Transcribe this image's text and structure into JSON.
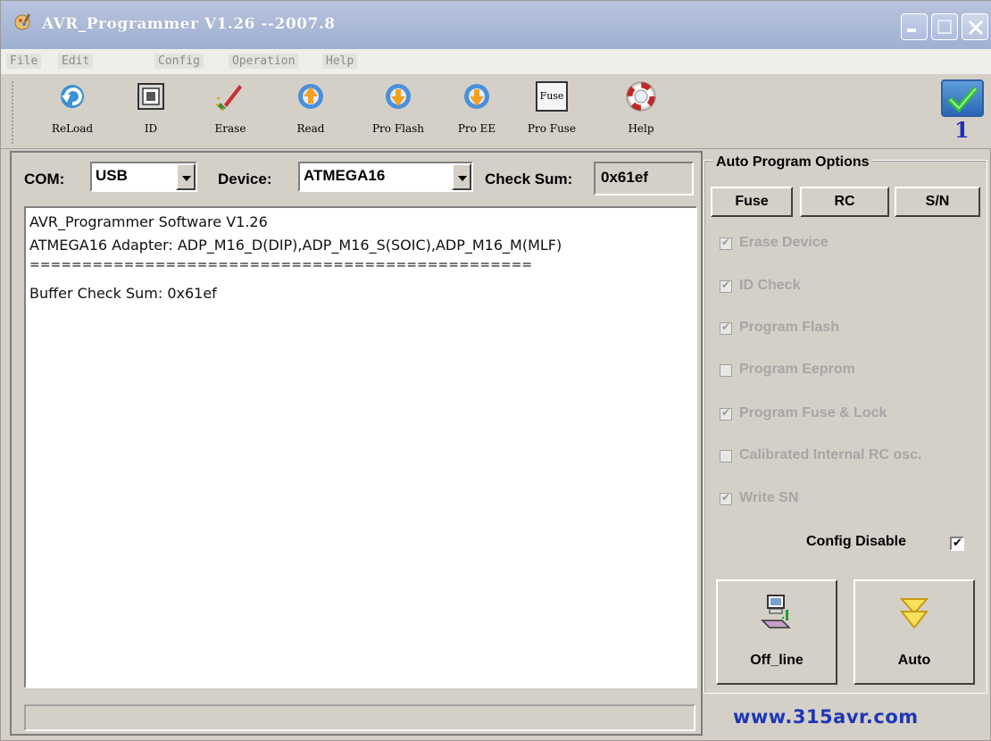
{
  "window": {
    "title": "AVR_Programmer V1.26 --2007.8"
  },
  "menu": [
    "File",
    "Edit",
    "Config",
    "Operation",
    "Help"
  ],
  "toolbar": {
    "buttons": [
      {
        "label": "ReLoad",
        "icon": "reload-icon"
      },
      {
        "label": "ID",
        "icon": "chip-id-icon"
      },
      {
        "label": "Erase",
        "icon": "erase-brush-icon"
      },
      {
        "label": "Read",
        "icon": "read-arrow-icon"
      },
      {
        "label": "Pro Flash",
        "icon": "program-flash-icon"
      },
      {
        "label": "Pro EE",
        "icon": "program-eeprom-icon"
      },
      {
        "label": "Pro Fuse",
        "icon": "fuse-icon"
      },
      {
        "label": "Help",
        "icon": "lifebuoy-icon"
      }
    ],
    "fuse_icon_text": "Fuse",
    "status_number": "1"
  },
  "com": {
    "label": "COM:",
    "value": "USB"
  },
  "device": {
    "label": "Device:",
    "value": "ATMEGA16"
  },
  "checksum": {
    "label": "Check Sum:",
    "value": "0x61ef"
  },
  "log": [
    "AVR_Programmer Software V1.26",
    "ATMEGA16 Adapter: ADP_M16_D(DIP),ADP_M16_S(SOIC),ADP_M16_M(MLF)",
    "================================================",
    "Buffer Check Sum: 0x61ef"
  ],
  "auto_options": {
    "title": "Auto Program Options",
    "tabs": [
      "Fuse",
      "RC",
      "S/N"
    ],
    "options": [
      {
        "label": "Erase Device",
        "checked": true
      },
      {
        "label": "ID Check",
        "checked": true
      },
      {
        "label": "Program Flash",
        "checked": true
      },
      {
        "label": "Program Eeprom",
        "checked": false
      },
      {
        "label": "Program Fuse & Lock",
        "checked": true
      },
      {
        "label": "Calibrated Internal RC osc.",
        "checked": false
      },
      {
        "label": "Write SN",
        "checked": true
      }
    ],
    "config_disable_label": "Config Disable",
    "config_disable_checked": true,
    "offline_label": "Off_line",
    "auto_label": "Auto"
  },
  "brand": "www.315avr.com",
  "colors": {
    "brand": "#1f37b5",
    "title_bar": "#9fb0d2",
    "status_check": "#2a66b5"
  }
}
